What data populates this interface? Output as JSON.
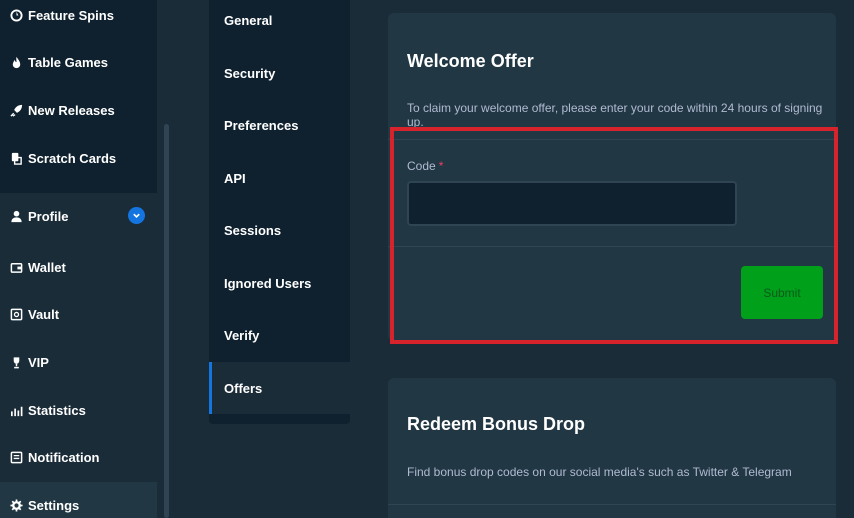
{
  "sidebar": {
    "items": [
      {
        "label": "Feature Spins",
        "icon": "feature-spins-icon"
      },
      {
        "label": "Table Games",
        "icon": "flame-icon"
      },
      {
        "label": "New Releases",
        "icon": "rocket-icon"
      },
      {
        "label": "Scratch Cards",
        "icon": "scratch-card-icon"
      },
      {
        "label": "Profile",
        "icon": "user-icon"
      },
      {
        "label": "Wallet",
        "icon": "wallet-icon"
      },
      {
        "label": "Vault",
        "icon": "vault-icon"
      },
      {
        "label": "VIP",
        "icon": "trophy-icon"
      },
      {
        "label": "Statistics",
        "icon": "statistics-icon"
      },
      {
        "label": "Notification",
        "icon": "notification-icon"
      },
      {
        "label": "Settings",
        "icon": "gear-icon"
      }
    ]
  },
  "settings_nav": {
    "items": [
      "General",
      "Security",
      "Preferences",
      "API",
      "Sessions",
      "Ignored Users",
      "Verify",
      "Offers"
    ],
    "active": "Offers"
  },
  "welcome_offer": {
    "title": "Welcome Offer",
    "description": "To claim your welcome offer, please enter your code within 24 hours of signing up.",
    "code_label": "Code",
    "required_mark": "*",
    "code_value": "",
    "submit_label": "Submit"
  },
  "bonus_drop": {
    "title": "Redeem Bonus Drop",
    "description": "Find bonus drop codes on our social media's such as Twitter & Telegram"
  },
  "colors": {
    "background": "#1a2c38",
    "sidebar": "#0f212e",
    "card": "#213743",
    "accent_blue": "#1475e1",
    "submit_green": "#00a01b",
    "highlight_red": "#d6232c"
  }
}
